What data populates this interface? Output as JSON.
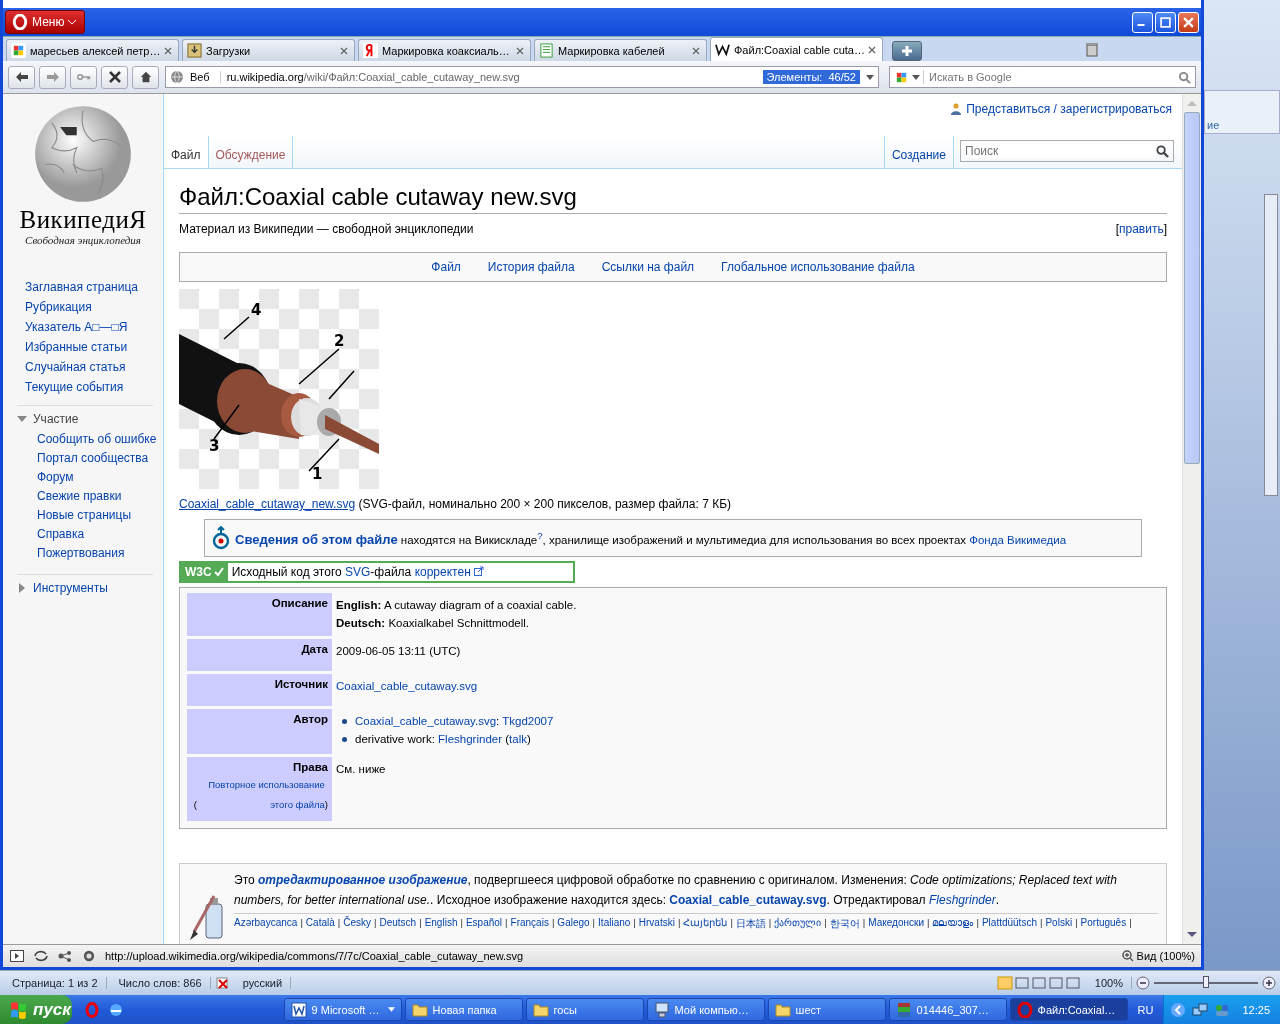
{
  "browser": {
    "menu_label": "Меню",
    "tabs": [
      {
        "title": "маресьев алексей петр…",
        "selected": false,
        "kind": "google"
      },
      {
        "title": "Загрузки",
        "selected": false,
        "kind": "download"
      },
      {
        "title": "Маркировка коаксиаль…",
        "selected": false,
        "kind": "yandex"
      },
      {
        "title": "Маркировка кабелей",
        "selected": false,
        "kind": "doc"
      },
      {
        "title": "Файл:Coaxial cable cuta…",
        "selected": true,
        "kind": "wiki"
      }
    ],
    "engine_label": "Веб",
    "address_host": "ru.wikipedia.org",
    "address_path": "/wiki/Файл:Coaxial_cable_cutaway_new.svg",
    "elements_badge": "Элементы:  46/52",
    "search_placeholder": "Искать в Google",
    "status_url": "http://upload.wikimedia.org/wikipedia/commons/7/7c/Coaxial_cable_cutaway_new.svg",
    "zoom_label": "Вид (100%)"
  },
  "wiki": {
    "login": "Представиться / зарегистрироваться",
    "logo_title": "ВикипедиЯ",
    "logo_subtitle": "Свободная энциклопедия",
    "nav": [
      "Заглавная страница",
      "Рубрикация",
      "Указатель А□—□Я",
      "Избранные статьи",
      "Случайная статья",
      "Текущие события"
    ],
    "portals": [
      {
        "label": "Участие",
        "expanded": true,
        "items": [
          "Сообщить об ошибке",
          "Портал сообщества",
          "Форум",
          "Свежие правки",
          "Новые страницы",
          "Справка",
          "Пожертвования"
        ]
      },
      {
        "label": "Инструменты",
        "expanded": false
      }
    ],
    "page_tabs": [
      {
        "label": "Файл",
        "selected": true
      },
      {
        "label": "Обсуждение",
        "selected": false
      }
    ],
    "action_tab": "Создание",
    "search_placeholder": "Поиск",
    "title": "Файл:Coaxial cable cutaway new.svg",
    "subtitle": "Материал из Википедии — свободной энциклопедии",
    "edit": [
      {
        "kind": "text",
        "text": "["
      },
      {
        "kind": "link",
        "text": "править"
      },
      {
        "kind": "text",
        "text": "]"
      }
    ],
    "file_nav": [
      "Файл",
      "История файла",
      "Ссылки на файл",
      "Глобальное использование файла"
    ],
    "diagram_labels": [
      "1",
      "2",
      "3",
      "4"
    ],
    "caption": [
      {
        "kind": "link",
        "text": "Coaxial_cable_cutaway_new.svg"
      },
      {
        "kind": "text",
        "text": " (SVG-файл, номинально 200 × 200 пикселов, размер файла: 7 КБ)"
      }
    ],
    "commons": [
      {
        "kind": "bold_link",
        "text": "Сведения об этом файле"
      },
      {
        "kind": "text",
        "text": " находятся на Викискладе"
      },
      {
        "kind": "sup_link",
        "text": "?"
      },
      {
        "kind": "text",
        "text": ", хранилище изображений и мультимедиа для использования во всех проектах "
      },
      {
        "kind": "link",
        "text": "Фонда Викимедиа"
      }
    ],
    "w3c_badge": "W3C",
    "w3c": [
      {
        "kind": "text",
        "text": "Исходный код этого "
      },
      {
        "kind": "link",
        "text": "SVG"
      },
      {
        "kind": "text",
        "text": "-файла "
      },
      {
        "kind": "ext_link",
        "text": "корректен"
      }
    ],
    "info_rows": [
      {
        "label": "Описание",
        "kind": "lines",
        "sublabel": [],
        "lines": [
          [
            {
              "kind": "text",
              "text": "**English:** A cutaway diagram of a coaxial cable."
            }
          ],
          [
            {
              "kind": "text",
              "text": "**Deutsch:** Koaxialkabel Schnittmodell."
            }
          ]
        ]
      },
      {
        "label": "Дата",
        "kind": "lines",
        "sublabel": [],
        "lines": [
          [
            {
              "kind": "text",
              "text": "2009-06-05 13:11 (UTC)"
            }
          ]
        ]
      },
      {
        "label": "Источник",
        "kind": "lines",
        "sublabel": [],
        "lines": [
          [
            {
              "kind": "link",
              "text": "Coaxial_cable_cutaway.svg"
            }
          ]
        ]
      },
      {
        "label": "Автор",
        "kind": "bullets",
        "sublabel": [],
        "lines": [
          [
            {
              "kind": "link",
              "text": "Coaxial_cable_cutaway.svg"
            },
            {
              "kind": "text",
              "text": ": "
            },
            {
              "kind": "link",
              "text": "Tkgd2007"
            }
          ],
          [
            {
              "kind": "text",
              "text": "derivative work: "
            },
            {
              "kind": "link",
              "text": "Fleshgrinder"
            },
            {
              "kind": "text",
              "text": " ("
            },
            {
              "kind": "link",
              "text": "talk"
            },
            {
              "kind": "text",
              "text": ")"
            }
          ]
        ]
      },
      {
        "label": "Права",
        "kind": "lines",
        "sublabel": [
          {
            "kind": "text",
            "text": "("
          },
          {
            "kind": "block_link",
            "text": "Повторное использование этого файла"
          },
          {
            "kind": "text",
            "text": ")"
          }
        ],
        "lines": [
          [
            {
              "kind": "text",
              "text": "См. ниже"
            }
          ]
        ]
      }
    ],
    "notice": [
      {
        "kind": "text",
        "text": "Это "
      },
      {
        "kind": "bold_italic_link",
        "text": "отредактированное изображение"
      },
      {
        "kind": "text",
        "text": ", подвергшееся цифровой обработке по сравнению с оригиналом. Изменения: "
      },
      {
        "kind": "italic",
        "text": "Code optimizations; Replaced text with numbers, for better international use."
      },
      {
        "kind": "text",
        "text": ". Исходное изображение находится здесь: "
      },
      {
        "kind": "bold_link",
        "text": "Coaxial_cable_cutaway.svg"
      },
      {
        "kind": "text",
        "text": ". Отредактировал "
      },
      {
        "kind": "italic_link",
        "text": "Fleshgrinder"
      },
      {
        "kind": "text",
        "text": "."
      }
    ],
    "language_separator": "|",
    "languages": [
      "Azərbaycanca",
      "Català",
      "Česky",
      "Deutsch",
      "English",
      "Español",
      "Français",
      "Galego",
      "Italiano",
      "Hrvatski",
      "Հայերեն",
      "日本語",
      "ქართული",
      "한국어",
      "Македонски",
      "മലയാളം",
      "Plattdüütsch",
      "Polski",
      "Português"
    ]
  },
  "word": {
    "ribbon_fragment": "ие",
    "page": "Страница: 1 из 2",
    "words": "Число слов: 866",
    "language": "русский",
    "zoom": "100%",
    "zoom_slider": {
      "level": 0.5
    }
  },
  "taskbar": {
    "start": "пуск",
    "tasks": [
      {
        "label": "9 Microsoft …",
        "kind": "word",
        "selected": false,
        "menu": true
      },
      {
        "label": "Новая папка",
        "kind": "folder",
        "selected": false,
        "menu": false
      },
      {
        "label": "госы",
        "kind": "folder",
        "selected": false,
        "menu": false
      },
      {
        "label": "Мой компью…",
        "kind": "computer",
        "selected": false,
        "menu": false
      },
      {
        "label": "шест",
        "kind": "folder",
        "selected": false,
        "menu": false
      },
      {
        "label": "014446_307…",
        "kind": "archive",
        "selected": false,
        "menu": false
      },
      {
        "label": "Файл:Coaxial…",
        "kind": "opera",
        "selected": true,
        "menu": false
      }
    ],
    "lang": "RU",
    "time": "12:25"
  }
}
